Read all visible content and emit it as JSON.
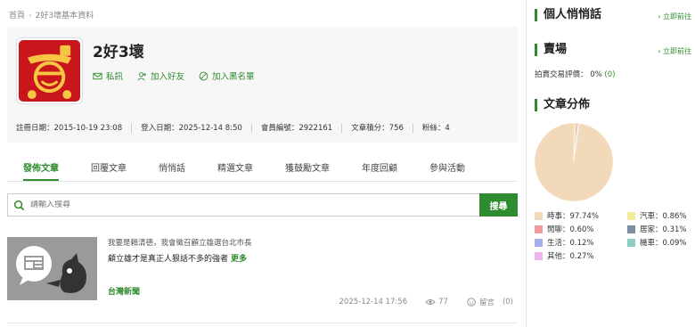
{
  "breadcrumb": {
    "home": "首頁",
    "current": "2好3壞基本資料"
  },
  "profile": {
    "username": "2好3壞",
    "actions": {
      "message": "私訊",
      "add_friend": "加入好友",
      "blacklist": "加入黑名單"
    },
    "stats": {
      "register": "註冊日期：2015-10-19 23:08",
      "login": "登入日期：2025-12-14 8:50",
      "member_id": "會員編號：2922161",
      "points": "文章積分：756",
      "fans": "粉絲：4"
    }
  },
  "tabs": [
    "發佈文章",
    "回覆文章",
    "悄悄話",
    "精選文章",
    "獲鼓勵文章",
    "年度回顧",
    "參與活動"
  ],
  "search": {
    "placeholder": "請輸入搜尋",
    "button": "搜尋"
  },
  "post": {
    "author_line": "我要是賴清德，我會徵召顧立雄選台北市長",
    "excerpt": "顧立雄才是真正人狠話不多的強者",
    "more": "更多",
    "board": "台灣新聞",
    "date": "2025-12-14 17:56",
    "views": "77",
    "comments_label": "留言",
    "comments": "(0)"
  },
  "sidebar": {
    "whisper": {
      "title": "個人悄悄話",
      "link": "立即前往"
    },
    "market": {
      "title": "賣場",
      "link": "立即前往",
      "rating_label": "拍賣交易評價：",
      "rating_pct": "0%",
      "rating_count": "(0)"
    },
    "article_dist": {
      "title": "文章分佈"
    }
  },
  "chart_data": {
    "type": "pie",
    "title": "文章分佈",
    "series": [
      {
        "name": "時事",
        "label": "時事：97.74%",
        "value": 97.74,
        "color": "#f2d9b9"
      },
      {
        "name": "汽車",
        "label": "汽車：0.86%",
        "value": 0.86,
        "color": "#f2ec9c"
      },
      {
        "name": "閒聊",
        "label": "閒聊：0.60%",
        "value": 0.6,
        "color": "#f29b9b"
      },
      {
        "name": "居家",
        "label": "居家：0.31%",
        "value": 0.31,
        "color": "#7d8fa0"
      },
      {
        "name": "生活",
        "label": "生活：0.12%",
        "value": 0.12,
        "color": "#a6aef0"
      },
      {
        "name": "機車",
        "label": "機車：0.09%",
        "value": 0.09,
        "color": "#8fcfc3"
      },
      {
        "name": "其他",
        "label": "其他：0.27%",
        "value": 0.27,
        "color": "#f0b3f0"
      }
    ]
  }
}
